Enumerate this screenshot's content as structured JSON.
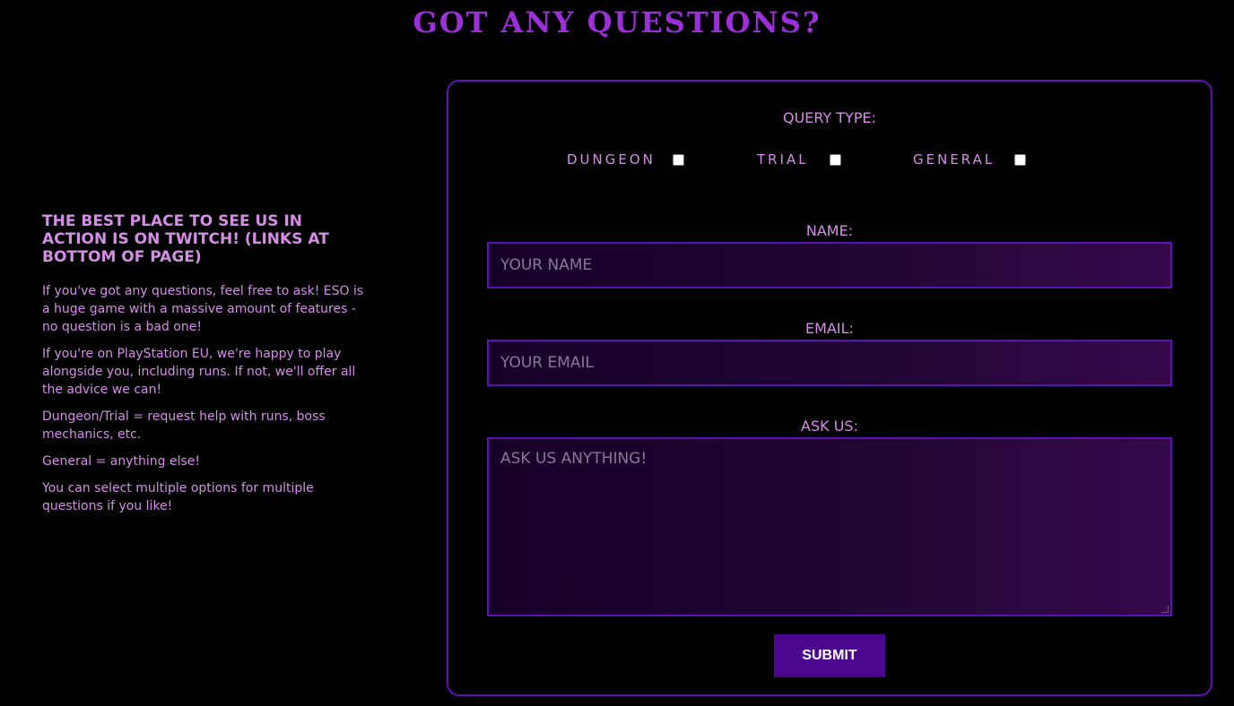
{
  "page": {
    "title": "GOT ANY QUESTIONS?"
  },
  "info": {
    "heading": "THE BEST PLACE TO SEE US IN ACTION IS ON TWITCH! (LINKS AT BOTTOM OF PAGE)",
    "paragraphs": [
      "If you've got any questions, feel free to ask! ESO is a huge game with a massive amount of features - no question is a bad one!",
      "If you're on PlayStation EU, we're happy to play alongside you, including runs. If not, we'll offer all the advice we can!",
      "Dungeon/Trial = request help with runs, boss mechanics, etc.",
      "General = anything else!",
      "You can select multiple options for multiple questions if you like!"
    ]
  },
  "form": {
    "query_label": "QUERY TYPE:",
    "query_options": [
      {
        "label": "DUNGEON",
        "checked": false
      },
      {
        "label": "TRIAL",
        "checked": false
      },
      {
        "label": "GENERAL",
        "checked": false
      }
    ],
    "name_label": "NAME:",
    "name_placeholder": "YOUR NAME",
    "email_label": "EMAIL:",
    "email_placeholder": "YOUR EMAIL",
    "ask_label": "ASK US:",
    "ask_placeholder": "ASK US ANYTHING!",
    "submit_label": "SUBMIT"
  },
  "colors": {
    "title": "#9b30d9",
    "text": "#d58ee6",
    "border": "#5a12b0",
    "button": "#4a0890"
  }
}
